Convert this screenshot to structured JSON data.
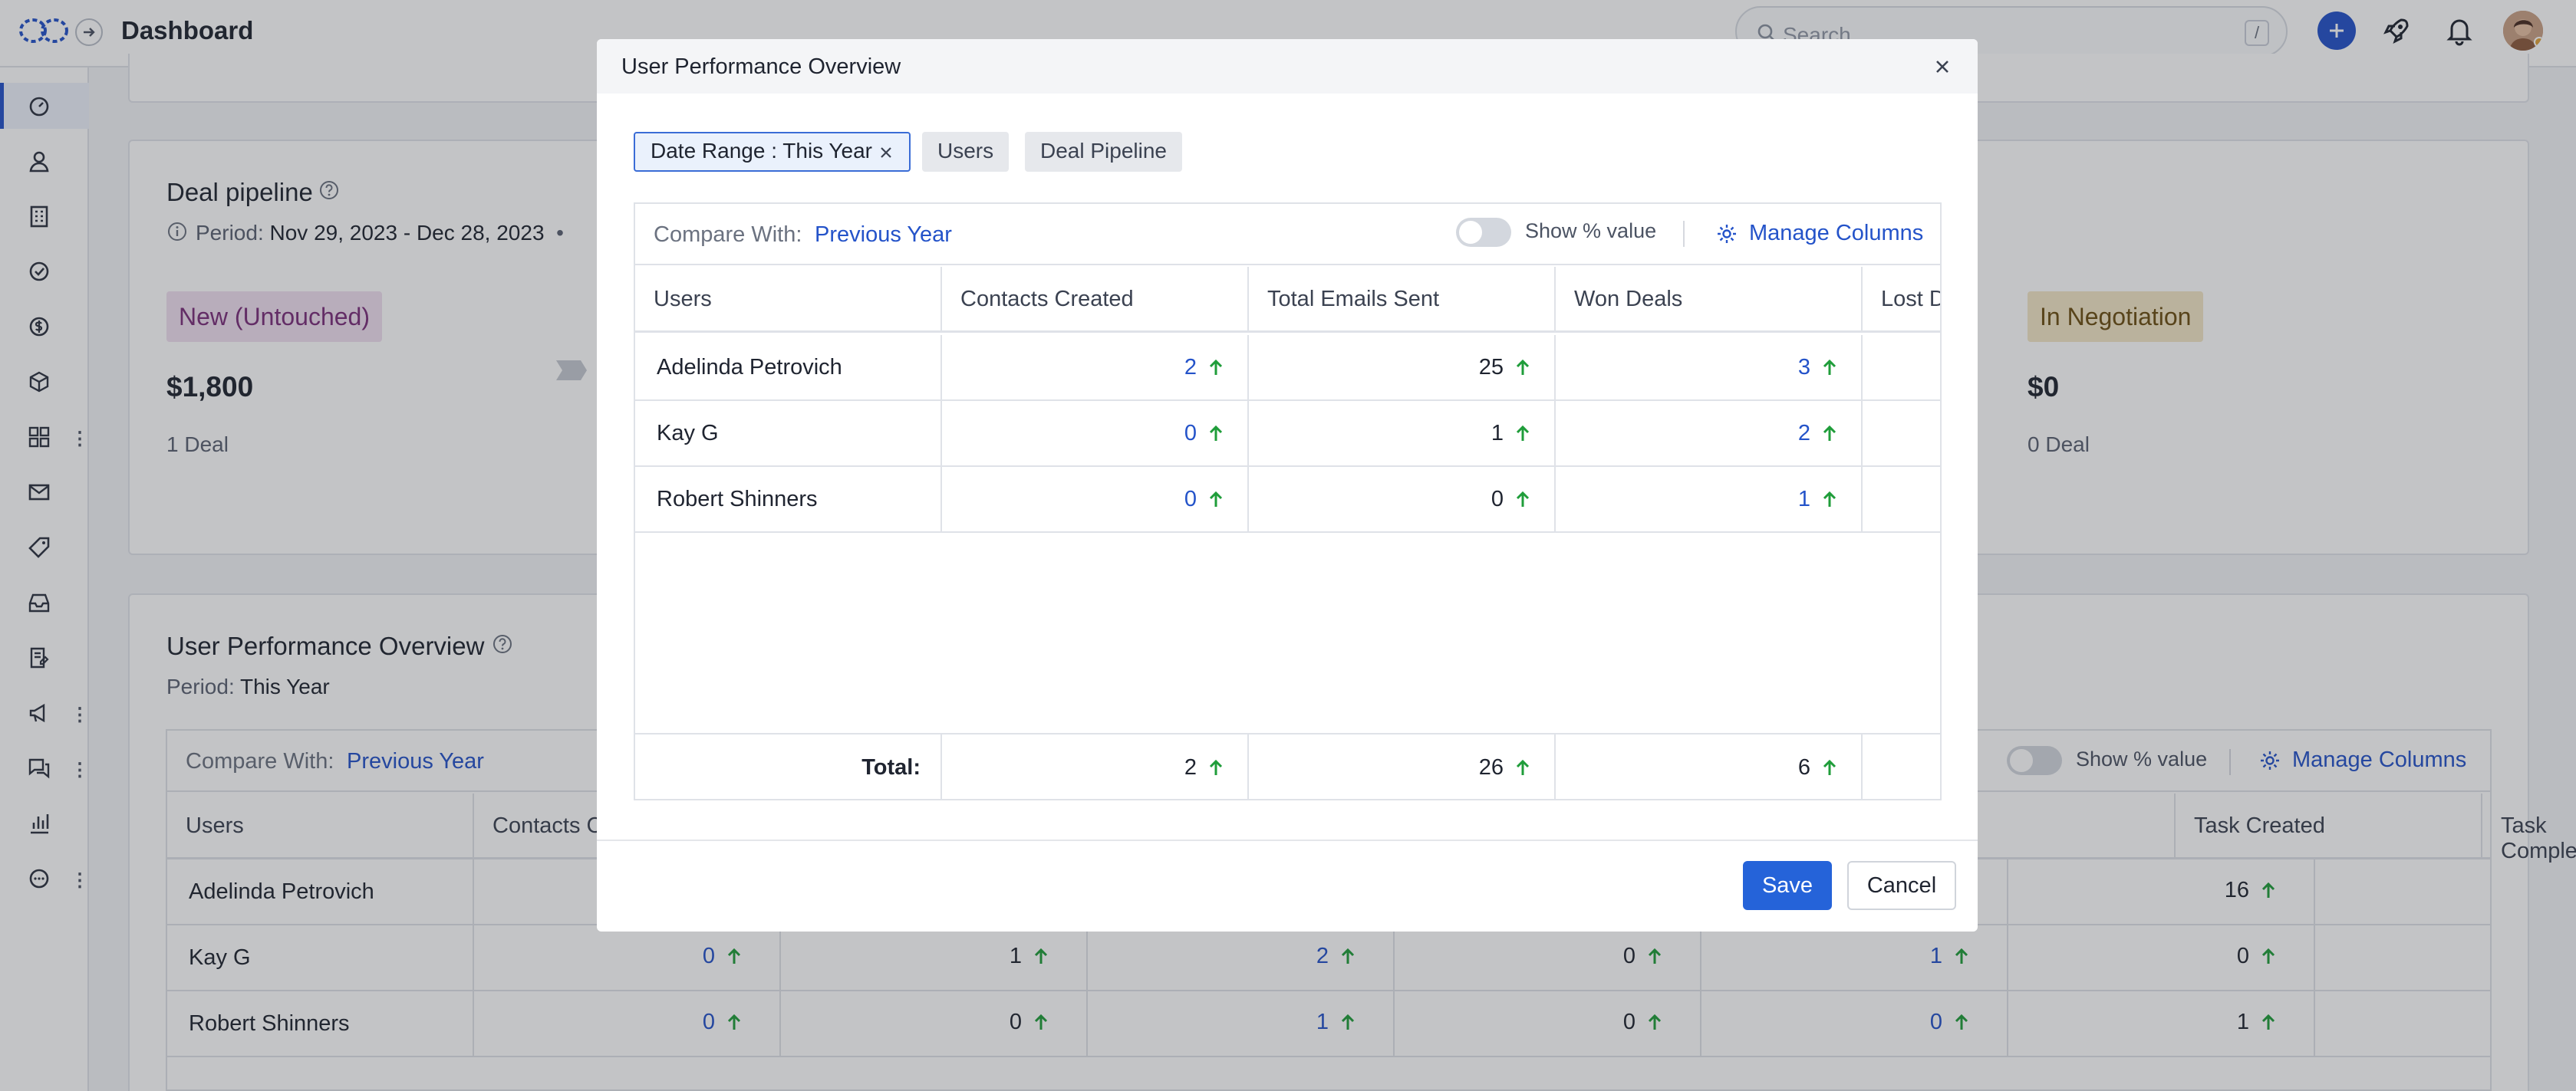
{
  "app": {
    "title": "Dashboard"
  },
  "search": {
    "placeholder": "Search",
    "shortcut": "/"
  },
  "sidebar": {
    "items": [
      "dashboard-icon",
      "contacts-icon",
      "companies-icon",
      "tasks-icon",
      "deals-icon",
      "products-icon",
      "apps-icon",
      "email-icon",
      "tags-icon",
      "inbox-icon",
      "forms-icon",
      "campaigns-icon",
      "chat-icon",
      "reports-icon",
      "more-icon"
    ]
  },
  "deal_pipeline": {
    "title": "Deal pipeline",
    "period_label": "Period:",
    "period_value": "Nov 29, 2023 - Dec 28, 2023",
    "stages": [
      {
        "name": "New (Untouched)",
        "amount": "$1,800",
        "deals": "1 Deal",
        "color": "#f0dff0",
        "text_color": "#7a2f7a"
      },
      {
        "name": "In Negotiation",
        "amount": "$0",
        "deals": "0 Deal",
        "color": "#f3e6c6",
        "text_color": "#6b4e12"
      }
    ]
  },
  "user_perf_bg": {
    "title": "User Performance Overview",
    "period_label": "Period:",
    "period_value": "This Year",
    "compare_label": "Compare With:",
    "compare_value": "Previous Year",
    "show_pct": "Show % value",
    "manage_columns": "Manage Columns",
    "headers": [
      "Users",
      "Contacts C",
      "Task Created",
      "Task Completed"
    ],
    "rows": [
      {
        "name": "Adelinda Petrovich",
        "vals": [
          "",
          "",
          "",
          "",
          "",
          "16"
        ]
      },
      {
        "name": "Kay G",
        "vals": [
          "0",
          "1",
          "2",
          "0",
          "1",
          "0"
        ]
      },
      {
        "name": "Robert Shinners",
        "vals": [
          "0",
          "0",
          "1",
          "0",
          "0",
          "1"
        ]
      }
    ]
  },
  "modal": {
    "title": "User Performance Overview",
    "chips": {
      "date_range": "Date Range : This Year",
      "users": "Users",
      "deal_pipeline": "Deal Pipeline"
    },
    "compare_label": "Compare With:",
    "compare_value": "Previous Year",
    "show_pct": "Show % value",
    "manage_columns": "Manage Columns",
    "headers": [
      "Users",
      "Contacts Created",
      "Total Emails Sent",
      "Won Deals",
      "Lost D"
    ],
    "rows": [
      {
        "name": "Adelinda Petrovich",
        "contacts": "2",
        "emails": "25",
        "won": "3"
      },
      {
        "name": "Kay G",
        "contacts": "0",
        "emails": "1",
        "won": "2"
      },
      {
        "name": "Robert Shinners",
        "contacts": "0",
        "emails": "0",
        "won": "1"
      }
    ],
    "total": {
      "label": "Total:",
      "contacts": "2",
      "emails": "26",
      "won": "6"
    },
    "save": "Save",
    "cancel": "Cancel"
  },
  "colors": {
    "accent": "#2453c9",
    "up_arrow": "#1f9d3a"
  }
}
